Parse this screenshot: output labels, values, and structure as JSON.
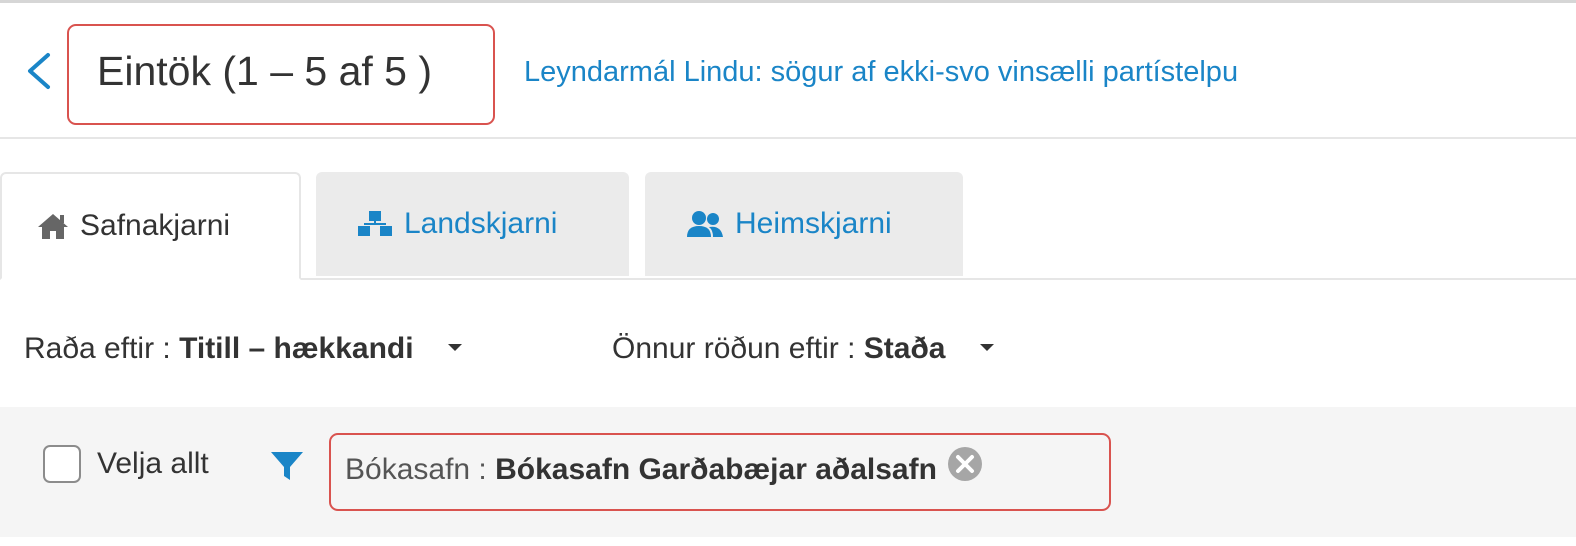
{
  "header": {
    "back_icon": "chevron-left-icon",
    "title": "Eintök (1 – 5 af 5 )",
    "record_link": "Leyndarmál Lindu: sögur af ekki-svo vinsælli partístelpu"
  },
  "tabs": [
    {
      "label": "Safnakjarni",
      "icon": "home-icon",
      "active": true
    },
    {
      "label": "Landskjarni",
      "icon": "sitemap-icon",
      "active": false
    },
    {
      "label": "Heimskjarni",
      "icon": "users-icon",
      "active": false
    }
  ],
  "sort": {
    "primary_label": "Raða eftir : ",
    "primary_value": "Titill – hækkandi",
    "secondary_label": "Önnur röðun eftir : ",
    "secondary_value": "Staða"
  },
  "filter_bar": {
    "select_all_label": "Velja allt",
    "filter_icon": "filter-icon",
    "chip_label": "Bókasafn : ",
    "chip_value": "Bókasafn Garðabæjar aðalsafn",
    "chip_remove_icon": "close-circle-icon"
  },
  "colors": {
    "link": "#1a85c7",
    "highlight_border": "#d9534f",
    "tab_inactive_bg": "#ebebeb",
    "filter_bar_bg": "#f5f5f5"
  }
}
